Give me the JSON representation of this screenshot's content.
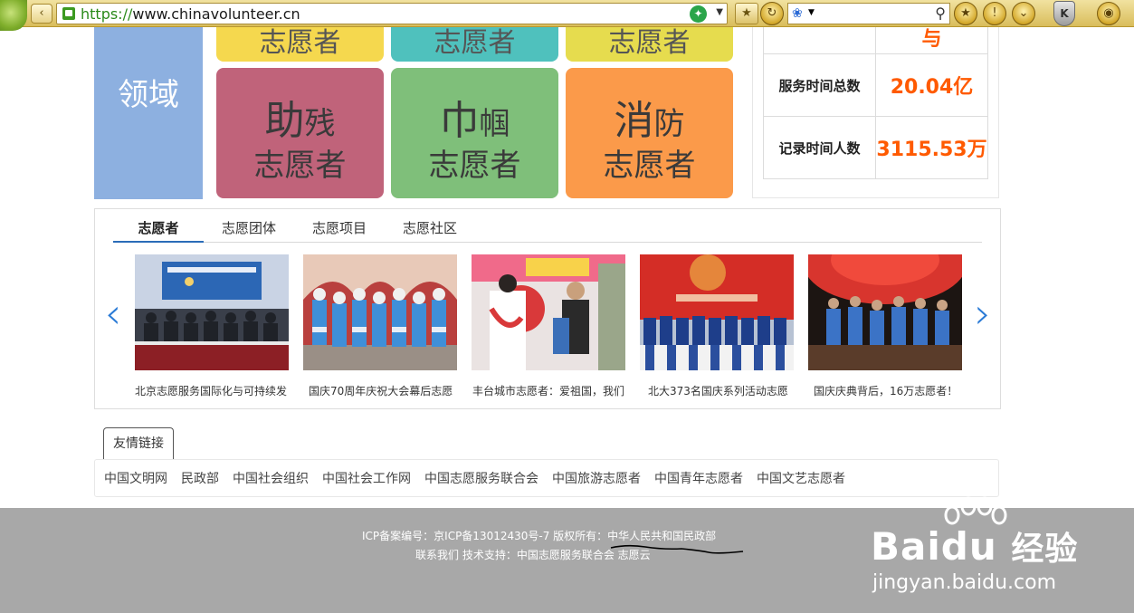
{
  "browser": {
    "url_protocol": "https://",
    "url_host": "www.chinavolunteer.cn",
    "back_label": "‹",
    "shield_label": "K"
  },
  "domains": {
    "label": "领域",
    "top_tiles": [
      "志愿者",
      "志愿者",
      "志愿者"
    ],
    "tiles": [
      {
        "big": "助",
        "small": "残",
        "sub": "志愿者",
        "color": "#c0637a"
      },
      {
        "big": "巾",
        "small": "帼",
        "sub": "志愿者",
        "color": "#7fbf7a"
      },
      {
        "big": "消",
        "small": "防",
        "sub": "志愿者",
        "color": "#fb9a4a"
      }
    ],
    "top_colors": [
      "#f5d84e",
      "#4fc1bd",
      "#e6dc4e"
    ]
  },
  "stats": {
    "top_value": "与",
    "rows": [
      {
        "label": "服务时间总数",
        "value": "20.04亿"
      },
      {
        "label": "记录时间人数",
        "value": "3115.53万"
      }
    ]
  },
  "gallery": {
    "tabs": [
      "志愿者",
      "志愿团体",
      "志愿项目",
      "志愿社区"
    ],
    "active_tab": 0,
    "prev": "‹",
    "next": "›",
    "items": [
      {
        "caption": "北京志愿服务国际化与可持续发"
      },
      {
        "caption": "国庆70周年庆祝大会幕后志愿"
      },
      {
        "caption": "丰台城市志愿者：爱祖国，我们"
      },
      {
        "caption": "北大373名国庆系列活动志愿"
      },
      {
        "caption": "国庆庆典背后，16万志愿者！"
      }
    ]
  },
  "friend_links": {
    "title": "友情链接",
    "links": [
      "中国文明网",
      "民政部",
      "中国社会组织",
      "中国社会工作网",
      "中国志愿服务联合会",
      "中国旅游志愿者",
      "中国青年志愿者",
      "中国文艺志愿者"
    ]
  },
  "footer": {
    "line1": "ICP备案编号：京ICP备13012430号-7    版权所有：中华人民共和国民政部",
    "line2": "联系我们    技术支持：中国志愿服务联合会    志愿云"
  },
  "watermark": {
    "logo": "Bai",
    "logo2": "du",
    "logo3": "经验",
    "url": "jingyan.baidu.com"
  }
}
